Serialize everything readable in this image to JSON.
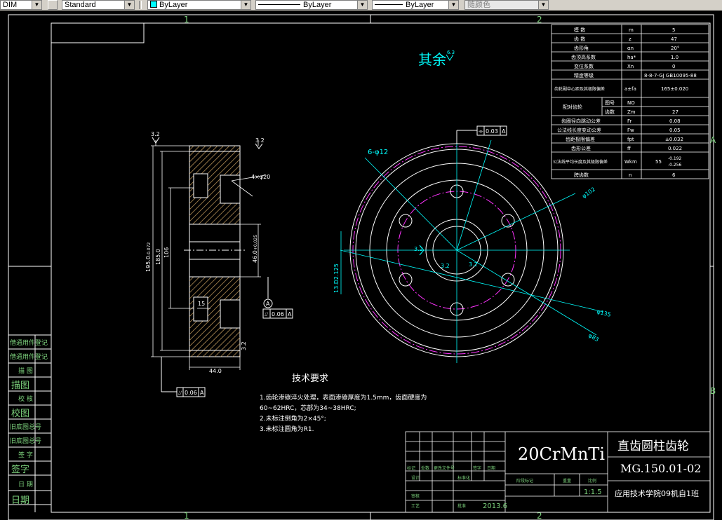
{
  "toolbar": {
    "dim_style": "DIM",
    "text_style": "Standard",
    "layer": "ByLayer",
    "linetype": "ByLayer",
    "lineweight": "ByLayer",
    "plot_style": "随颜色"
  },
  "border": {
    "zone_numbers": [
      "1",
      "2"
    ],
    "zone_letters": [
      "A",
      "B"
    ]
  },
  "surface_note": {
    "text": "其余",
    "roughness": "6.3"
  },
  "side_view": {
    "roughness_left": "3.2",
    "roughness_right": "3.2",
    "roughness_bottom": "3.2",
    "hole_callout": "4×φ20",
    "dim_width": "44.0",
    "dim_hub": "15",
    "dim_od": "195.0",
    "dim_od_tol": "-0.072",
    "dim_d2": "185.0",
    "dim_d3": "106",
    "dim_bore": "46.0",
    "dim_bore_tol": "+0.025",
    "datum": "A",
    "tol_bottom_sym": "⌰",
    "tol_bottom_val": "0.06",
    "tol_bottom_ref": "A",
    "tol_side_sym": "⌰",
    "tol_side_val": "0.06",
    "tol_side_ref": "A"
  },
  "front_view": {
    "tol_top_sym": "⌯",
    "tol_top_val": "0.03",
    "tol_top_ref": "A",
    "hole_label": "6-φ12",
    "dim_circle1": "φ102",
    "dim_circle2": "φ135",
    "dim_circle3": "φ83",
    "dim_keyway": "13.D2.125",
    "rough1": "3.2",
    "rough2": "3.2",
    "rough3": "3.2"
  },
  "param_table": {
    "rows": [
      [
        "模 数",
        "m",
        "5"
      ],
      [
        "齿 数",
        "z",
        "47"
      ],
      [
        "齿形角",
        "αn",
        "20°"
      ],
      [
        "齿顶高系数",
        "ha*",
        "1.0"
      ],
      [
        "变位系数",
        "Xn",
        "0"
      ],
      [
        "精度等级",
        "",
        "8-8-7-GJ GB10095-88"
      ],
      [
        "齿轮副中心距及其极限偏差",
        "a±fa",
        "165±0.020"
      ],
      [
        "配对齿轮",
        "图号",
        "NO",
        ""
      ],
      [
        "",
        "齿数",
        "Zm",
        "27"
      ],
      [
        "齿圈径向跳动公差",
        "Fr",
        "0.08"
      ],
      [
        "公法线长度变动公差",
        "Fw",
        "0.05"
      ],
      [
        "齿距极限偏差",
        "fpt",
        "±0.032"
      ],
      [
        "齿形公差",
        "ff",
        "0.022"
      ],
      [
        "公法线平均长度及其极限偏差",
        "Wkm",
        "55",
        "-0.192",
        "-0.256"
      ],
      [
        "跨齿数",
        "n",
        "6"
      ]
    ]
  },
  "tech_req": {
    "title": "技术要求",
    "lines": [
      "1.齿轮渗碳淬火处理，表面渗碳厚度为1.5mm，齿面硬度为",
      "60~62HRC，芯部为34~38HRC;",
      "2.未标注倒角为2×45°;",
      "3.未标注圆角为R1."
    ]
  },
  "title_block": {
    "material": "20CrMnTi",
    "part_name": "直齿圆柱齿轮",
    "drawing_no": "MG.150.01-02",
    "scale": "1:1.5",
    "school": "应用技术学院09机自1班",
    "date": "2013.6",
    "labels": [
      "标记",
      "处数",
      "更改文件号",
      "签字",
      "日期",
      "设计",
      "标准化",
      "阶段标记",
      "重量",
      "比例",
      "审核",
      "工艺",
      "批准"
    ]
  },
  "left_strip": {
    "labels": [
      "借通用件登记",
      "借通用件登记",
      "描 图",
      "描图",
      "校 核",
      "校图",
      "旧底图总号",
      "旧底图总号",
      "签 字",
      "签字",
      "日 期",
      "日期"
    ]
  }
}
